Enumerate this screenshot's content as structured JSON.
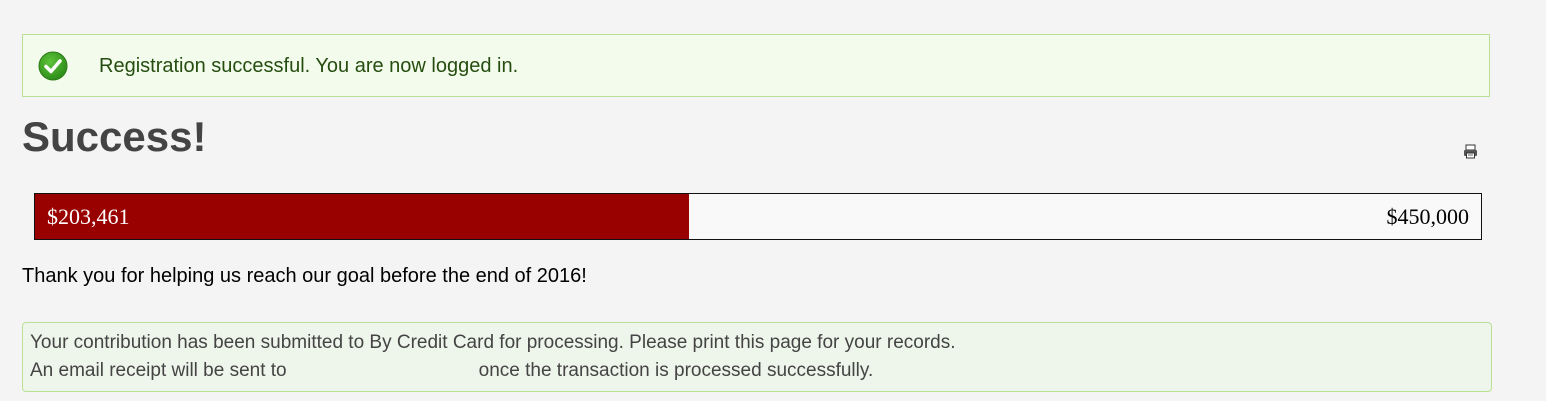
{
  "alert": {
    "icon": "check-circle-icon",
    "message": "Registration successful. You are now logged in."
  },
  "page": {
    "title": "Success!",
    "print_icon": "print-icon"
  },
  "progress": {
    "raised": "$203,461",
    "goal": "$450,000",
    "fraction": 0.452,
    "fill_color": "#990000"
  },
  "thanks": {
    "text": "Thank you for helping us reach our goal before the end of 2016!"
  },
  "notice": {
    "line1": "Your contribution has been submitted to By Credit Card for processing. Please print this page for your records.",
    "line2_prefix": "An email receipt will be sent to",
    "line2_suffix": "once the transaction is processed successfully."
  },
  "colors": {
    "alert_bg": "#f3fcec",
    "alert_border": "#b9e094",
    "check_green": "#3a9a1e",
    "progress_fill": "#990000"
  }
}
